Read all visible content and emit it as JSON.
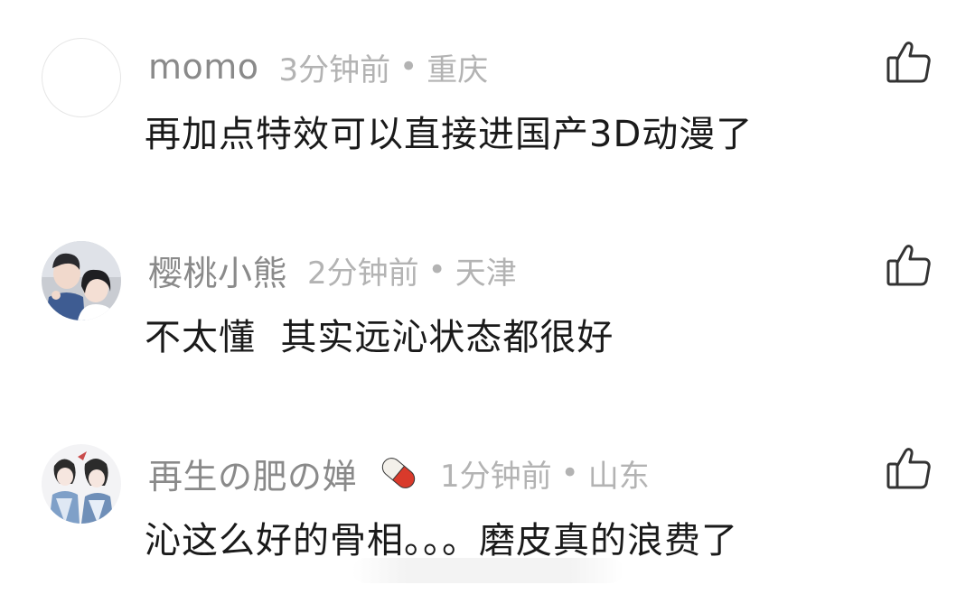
{
  "comments": [
    {
      "username": "momo",
      "time": "3分钟前",
      "dot": "•",
      "location": "重庆",
      "text": "再加点特效可以直接进国产3D动漫了",
      "avatar": "blank-avatar",
      "like_icon": "thumbs-up-icon"
    },
    {
      "username": "樱桃小熊",
      "time": "2分钟前",
      "dot": "•",
      "location": "天津",
      "text": "不太懂  其实远沁状态都很好",
      "avatar": "photo-avatar-couple",
      "like_icon": "thumbs-up-icon"
    },
    {
      "username": "再生の肥の婵",
      "time": "1分钟前",
      "dot": "•",
      "location": "山东",
      "text": "沁这么好的骨相。。。磨皮真的浪费了",
      "avatar": "illustrated-avatar-pair",
      "badge_icon": "pill-capsule-icon",
      "like_icon": "thumbs-up-icon"
    }
  ],
  "colors": {
    "username": "#8a8a8a",
    "meta": "#b3b3b3",
    "text": "#1a1a1a",
    "icon_stroke": "#333333"
  }
}
